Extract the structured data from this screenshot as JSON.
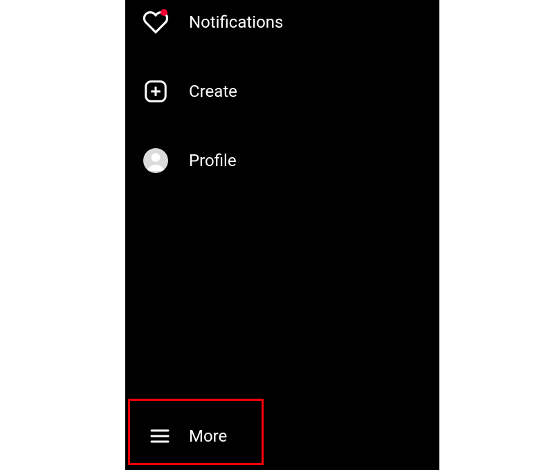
{
  "sidebar": {
    "items": [
      {
        "label": "Notifications",
        "icon": "heart-icon",
        "hasNotification": true
      },
      {
        "label": "Create",
        "icon": "plus-square-icon"
      },
      {
        "label": "Profile",
        "icon": "avatar-icon"
      },
      {
        "label": "More",
        "icon": "hamburger-icon"
      }
    ]
  },
  "highlight": {
    "target": "more"
  }
}
